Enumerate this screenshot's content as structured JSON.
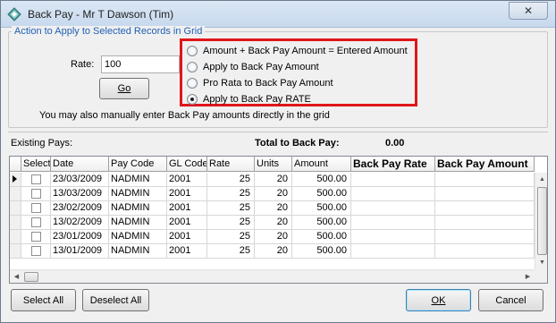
{
  "window": {
    "title": "Back Pay - Mr T Dawson (Tim)",
    "close_glyph": "✕"
  },
  "action_group": {
    "legend": "Action to Apply to Selected Records in Grid",
    "rate_label": "Rate:",
    "rate_value": "100",
    "go_label": "Go",
    "manual_note": "You may also manually enter Back Pay amounts directly in the grid",
    "options": [
      {
        "label": "Amount + Back Pay Amount = Entered Amount",
        "checked": false
      },
      {
        "label": "Apply to Back Pay Amount",
        "checked": false
      },
      {
        "label": "Pro Rata to Back Pay Amount",
        "checked": false
      },
      {
        "label": "Apply to Back Pay RATE",
        "checked": true
      }
    ],
    "highlight_color": "#e0161b"
  },
  "summary": {
    "existing_pays_label": "Existing Pays:",
    "total_label": "Total to Back Pay:",
    "total_value": "0.00"
  },
  "grid": {
    "columns": [
      "",
      "Select",
      "Date",
      "Pay Code",
      "GL Code",
      "Rate",
      "Units",
      "Amount",
      "Back Pay Rate",
      "Back Pay Amount"
    ],
    "rows": [
      {
        "date": "23/03/2009",
        "pay_code": "NADMIN",
        "gl_code": "2001",
        "rate": "25",
        "units": "20",
        "amount": "500.00",
        "back_pay_rate": "",
        "back_pay_amount": "",
        "selected": false,
        "current": true
      },
      {
        "date": "13/03/2009",
        "pay_code": "NADMIN",
        "gl_code": "2001",
        "rate": "25",
        "units": "20",
        "amount": "500.00",
        "back_pay_rate": "",
        "back_pay_amount": "",
        "selected": false,
        "current": false
      },
      {
        "date": "23/02/2009",
        "pay_code": "NADMIN",
        "gl_code": "2001",
        "rate": "25",
        "units": "20",
        "amount": "500.00",
        "back_pay_rate": "",
        "back_pay_amount": "",
        "selected": false,
        "current": false
      },
      {
        "date": "13/02/2009",
        "pay_code": "NADMIN",
        "gl_code": "2001",
        "rate": "25",
        "units": "20",
        "amount": "500.00",
        "back_pay_rate": "",
        "back_pay_amount": "",
        "selected": false,
        "current": false
      },
      {
        "date": "23/01/2009",
        "pay_code": "NADMIN",
        "gl_code": "2001",
        "rate": "25",
        "units": "20",
        "amount": "500.00",
        "back_pay_rate": "",
        "back_pay_amount": "",
        "selected": false,
        "current": false
      },
      {
        "date": "13/01/2009",
        "pay_code": "NADMIN",
        "gl_code": "2001",
        "rate": "25",
        "units": "20",
        "amount": "500.00",
        "back_pay_rate": "",
        "back_pay_amount": "",
        "selected": false,
        "current": false
      }
    ]
  },
  "buttons": {
    "select_all": "Select All",
    "deselect_all": "Deselect All",
    "ok": "OK",
    "cancel": "Cancel"
  }
}
